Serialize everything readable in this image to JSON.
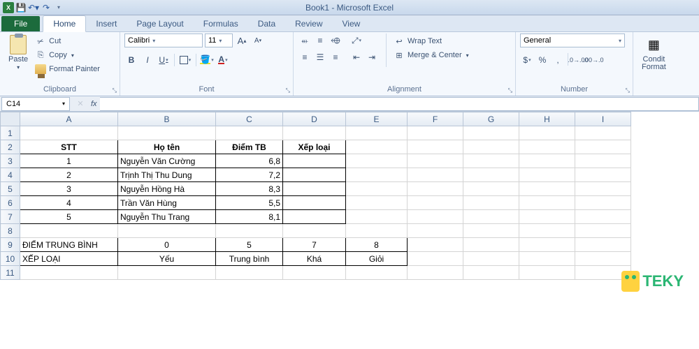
{
  "window": {
    "title": "Book1 - Microsoft Excel"
  },
  "tabs": {
    "file": "File",
    "items": [
      "Home",
      "Insert",
      "Page Layout",
      "Formulas",
      "Data",
      "Review",
      "View"
    ],
    "active": "Home"
  },
  "ribbon": {
    "clipboard": {
      "label": "Clipboard",
      "paste": "Paste",
      "cut": "Cut",
      "copy": "Copy",
      "fp": "Format Painter"
    },
    "font": {
      "label": "Font",
      "name": "Calibri",
      "size": "11"
    },
    "alignment": {
      "label": "Alignment",
      "wrap": "Wrap Text",
      "merge": "Merge & Center"
    },
    "number": {
      "label": "Number",
      "format": "General"
    },
    "styles": {
      "cond": "Condit\nFormat"
    }
  },
  "namebox": {
    "ref": "C14",
    "fx": "fx"
  },
  "cols": [
    "A",
    "B",
    "C",
    "D",
    "E",
    "F",
    "G",
    "H",
    "I"
  ],
  "sheet": {
    "headers": {
      "stt": "STT",
      "hoten": "Họ tên",
      "diemtb": "Điểm TB",
      "xeploai": "Xếp loại"
    },
    "rows": [
      {
        "stt": "1",
        "name": "Nguyễn Văn Cường",
        "score": "6,8"
      },
      {
        "stt": "2",
        "name": "Trịnh Thị Thu Dung",
        "score": "7,2"
      },
      {
        "stt": "3",
        "name": "Nguyễn Hồng Hà",
        "score": "8,3"
      },
      {
        "stt": "4",
        "name": "Trần Văn Hùng",
        "score": "5,5"
      },
      {
        "stt": "5",
        "name": "Nguyễn Thu Trang",
        "score": "8,1"
      }
    ],
    "lookup": {
      "dtb_label": "ĐIỂM TRUNG BÌNH",
      "xl_label": "XẾP LOẠI",
      "r9": [
        "0",
        "5",
        "7",
        "8"
      ],
      "r10": [
        "Yếu",
        "Trung bình",
        "Khá",
        "Giỏi"
      ]
    }
  },
  "watermark": "TEKY"
}
